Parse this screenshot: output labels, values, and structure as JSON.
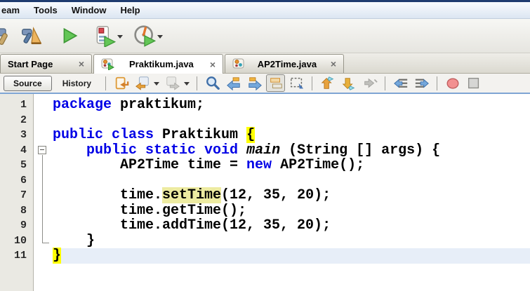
{
  "menu_bar": {
    "items": [
      {
        "label": "eam"
      },
      {
        "label": "Tools"
      },
      {
        "label": "Window"
      },
      {
        "label": "Help"
      }
    ]
  },
  "main_toolbar": {
    "icons": [
      "build-project",
      "clean-and-build-project",
      "run-project",
      "debug-project",
      "profile-project"
    ]
  },
  "tab_bar": {
    "tabs": [
      {
        "label": "Start Page",
        "icon": "none",
        "selected": false,
        "close": "x"
      },
      {
        "label": "Praktikum.java",
        "icon": "java-class-run",
        "selected": true,
        "close": "x"
      },
      {
        "label": "AP2Time.java",
        "icon": "java-class",
        "selected": false,
        "close": "x"
      }
    ]
  },
  "editor_toolbar": {
    "source_label": "Source",
    "history_label": "History",
    "icons": [
      "last-edit-position",
      "back",
      "forward",
      "find",
      "find-previous",
      "find-next",
      "toggle-highlight-search",
      "rectangular-selection",
      "previous-bookmark",
      "next-bookmark",
      "toggle-bookmark",
      "shift-line-left",
      "shift-line-right",
      "start-macro-recording",
      "stop-macro-recording"
    ]
  },
  "editor": {
    "colors": {
      "keyword": "#0000E6",
      "plain": "#000000",
      "brace_highlight": "#FFFF00",
      "occurrence_highlight": "#EDEBA1",
      "current_line": "#E7EEF8",
      "gutter_bg": "#EAE9E3"
    },
    "lines": [
      {
        "num": "1",
        "fold": "",
        "current": false,
        "segments": [
          {
            "t": "package",
            "s": "kw"
          },
          {
            "t": " praktikum;",
            "s": "pl"
          }
        ]
      },
      {
        "num": "2",
        "fold": "",
        "current": false,
        "segments": []
      },
      {
        "num": "3",
        "fold": "",
        "current": false,
        "segments": [
          {
            "t": "public class",
            "s": "kw"
          },
          {
            "t": " Praktikum ",
            "s": "pl"
          },
          {
            "t": "{",
            "s": "brace"
          }
        ]
      },
      {
        "num": "4",
        "fold": "start",
        "current": false,
        "segments": [
          {
            "t": "    ",
            "s": "pl"
          },
          {
            "t": "public static void",
            "s": "kw"
          },
          {
            "t": " ",
            "s": "pl"
          },
          {
            "t": "main",
            "s": "main"
          },
          {
            "t": " (String [] args) {",
            "s": "pl"
          }
        ]
      },
      {
        "num": "5",
        "fold": "mid",
        "current": false,
        "segments": [
          {
            "t": "        AP2Time time = ",
            "s": "pl"
          },
          {
            "t": "new",
            "s": "kw"
          },
          {
            "t": " AP2Time();",
            "s": "pl"
          }
        ]
      },
      {
        "num": "6",
        "fold": "mid",
        "current": false,
        "segments": []
      },
      {
        "num": "7",
        "fold": "mid",
        "current": false,
        "segments": [
          {
            "t": "        time.",
            "s": "pl"
          },
          {
            "t": "setTime",
            "s": "occ"
          },
          {
            "t": "(12, 35, 20);",
            "s": "pl"
          }
        ]
      },
      {
        "num": "8",
        "fold": "mid",
        "current": false,
        "segments": [
          {
            "t": "        time.getTime();",
            "s": "pl"
          }
        ]
      },
      {
        "num": "9",
        "fold": "mid",
        "current": false,
        "segments": [
          {
            "t": "        time.addTime(12, 35, 20);",
            "s": "pl"
          }
        ]
      },
      {
        "num": "10",
        "fold": "end",
        "current": false,
        "segments": [
          {
            "t": "    }",
            "s": "pl"
          }
        ]
      },
      {
        "num": "11",
        "fold": "",
        "current": true,
        "segments": [
          {
            "t": "}",
            "s": "brace"
          }
        ]
      }
    ]
  }
}
